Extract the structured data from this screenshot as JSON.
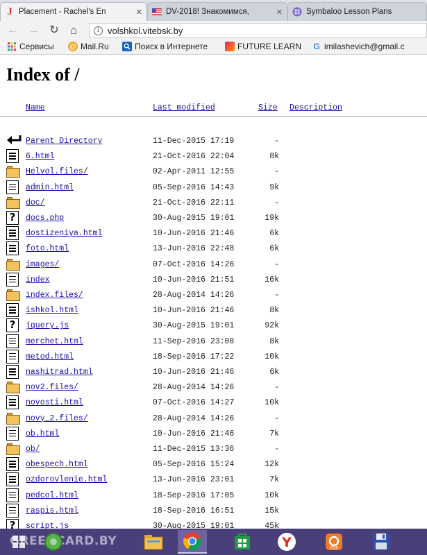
{
  "tabs": [
    {
      "title": "Placement - Rachel's En",
      "favicon": "J",
      "color": "#d93025"
    },
    {
      "title": "DV-2018! Знакомимся,",
      "favicon": "us-flag-icon",
      "color": "#3c5aa6"
    },
    {
      "title": "Symbaloo Lesson Plans",
      "favicon": "globe-icon",
      "color": "#7b68c9"
    }
  ],
  "address": {
    "url": "volshkol.vitebsk.by"
  },
  "bookmarks": [
    {
      "label": "Сервисы",
      "icon": "apps-grid-icon"
    },
    {
      "label": "Mail.Ru",
      "icon": "at-icon"
    },
    {
      "label": "Поиск в Интернете",
      "icon": "search-icon"
    },
    {
      "label": "FUTURE LEARN",
      "icon": "futurelearn-icon"
    },
    {
      "label": "imilashevich@gmail.c",
      "icon": "google-icon"
    }
  ],
  "page": {
    "title": "Index of /",
    "columns": {
      "name": "Name",
      "modified": "Last modified",
      "size": "Size",
      "description": "Description"
    },
    "rows": [
      {
        "name": "Parent Directory",
        "date": "11-Dec-2015 17:19",
        "size": "-",
        "icon": "back"
      },
      {
        "name": "6.html",
        "date": "21-Oct-2016 22:04",
        "size": "8k",
        "icon": "doc"
      },
      {
        "name": "Helvol.files/",
        "date": "02-Apr-2011 12:55",
        "size": "-",
        "icon": "folder"
      },
      {
        "name": "admin.html",
        "date": "05-Sep-2016 14:43",
        "size": "9k",
        "icon": "doc"
      },
      {
        "name": "doc/",
        "date": "21-Oct-2016 22:11",
        "size": "-",
        "icon": "folder"
      },
      {
        "name": "docs.php",
        "date": "30-Aug-2015 19:01",
        "size": "19k",
        "icon": "unknown"
      },
      {
        "name": "dostizeniya.html",
        "date": "10-Jun-2016 21:46",
        "size": "6k",
        "icon": "doc"
      },
      {
        "name": "foto.html",
        "date": "13-Jun-2016 22:48",
        "size": "6k",
        "icon": "doc"
      },
      {
        "name": "images/",
        "date": "07-Oct-2016 14:26",
        "size": "-",
        "icon": "folder"
      },
      {
        "name": "index",
        "date": "10-Jun-2016 21:51",
        "size": "16k",
        "icon": "doc"
      },
      {
        "name": "index.files/",
        "date": "28-Aug-2014 14:26",
        "size": "-",
        "icon": "folder"
      },
      {
        "name": "ishkol.html",
        "date": "10-Jun-2016 21:46",
        "size": "8k",
        "icon": "doc"
      },
      {
        "name": "jquery.js",
        "date": "30-Aug-2015 19:01",
        "size": "92k",
        "icon": "unknown"
      },
      {
        "name": "merchet.html",
        "date": "11-Sep-2016 23:08",
        "size": "8k",
        "icon": "doc"
      },
      {
        "name": "metod.html",
        "date": "18-Sep-2016 17:22",
        "size": "10k",
        "icon": "doc"
      },
      {
        "name": "nashitrad.html",
        "date": "10-Jun-2016 21:46",
        "size": "6k",
        "icon": "doc"
      },
      {
        "name": "nov2.files/",
        "date": "28-Aug-2014 14:26",
        "size": "-",
        "icon": "folder"
      },
      {
        "name": "novosti.html",
        "date": "07-Oct-2016 14:27",
        "size": "10k",
        "icon": "doc"
      },
      {
        "name": "novy_2.files/",
        "date": "28-Aug-2014 14:26",
        "size": "-",
        "icon": "folder"
      },
      {
        "name": "ob.html",
        "date": "10-Jun-2016 21:46",
        "size": "7k",
        "icon": "doc"
      },
      {
        "name": "ob/",
        "date": "11-Dec-2015 13:36",
        "size": "-",
        "icon": "folder"
      },
      {
        "name": "obespech.html",
        "date": "05-Sep-2016 15:24",
        "size": "12k",
        "icon": "doc"
      },
      {
        "name": "ozdorovlenie.html",
        "date": "13-Jun-2016 23:01",
        "size": "7k",
        "icon": "doc"
      },
      {
        "name": "pedcol.html",
        "date": "18-Sep-2016 17:05",
        "size": "10k",
        "icon": "doc"
      },
      {
        "name": "raspis.html",
        "date": "18-Sep-2016 16:51",
        "size": "15k",
        "icon": "doc"
      },
      {
        "name": "script.js",
        "date": "30-Aug-2015 19:01",
        "size": "45k",
        "icon": "unknown"
      }
    ]
  },
  "taskbar": {
    "watermark": "GREENCARD.BY",
    "items": [
      "windows-start-icon",
      "green-app-icon",
      "file-explorer-icon",
      "chrome-icon",
      "store-icon",
      "yandex-icon",
      "pdf-icon",
      "save-disk-icon"
    ]
  }
}
